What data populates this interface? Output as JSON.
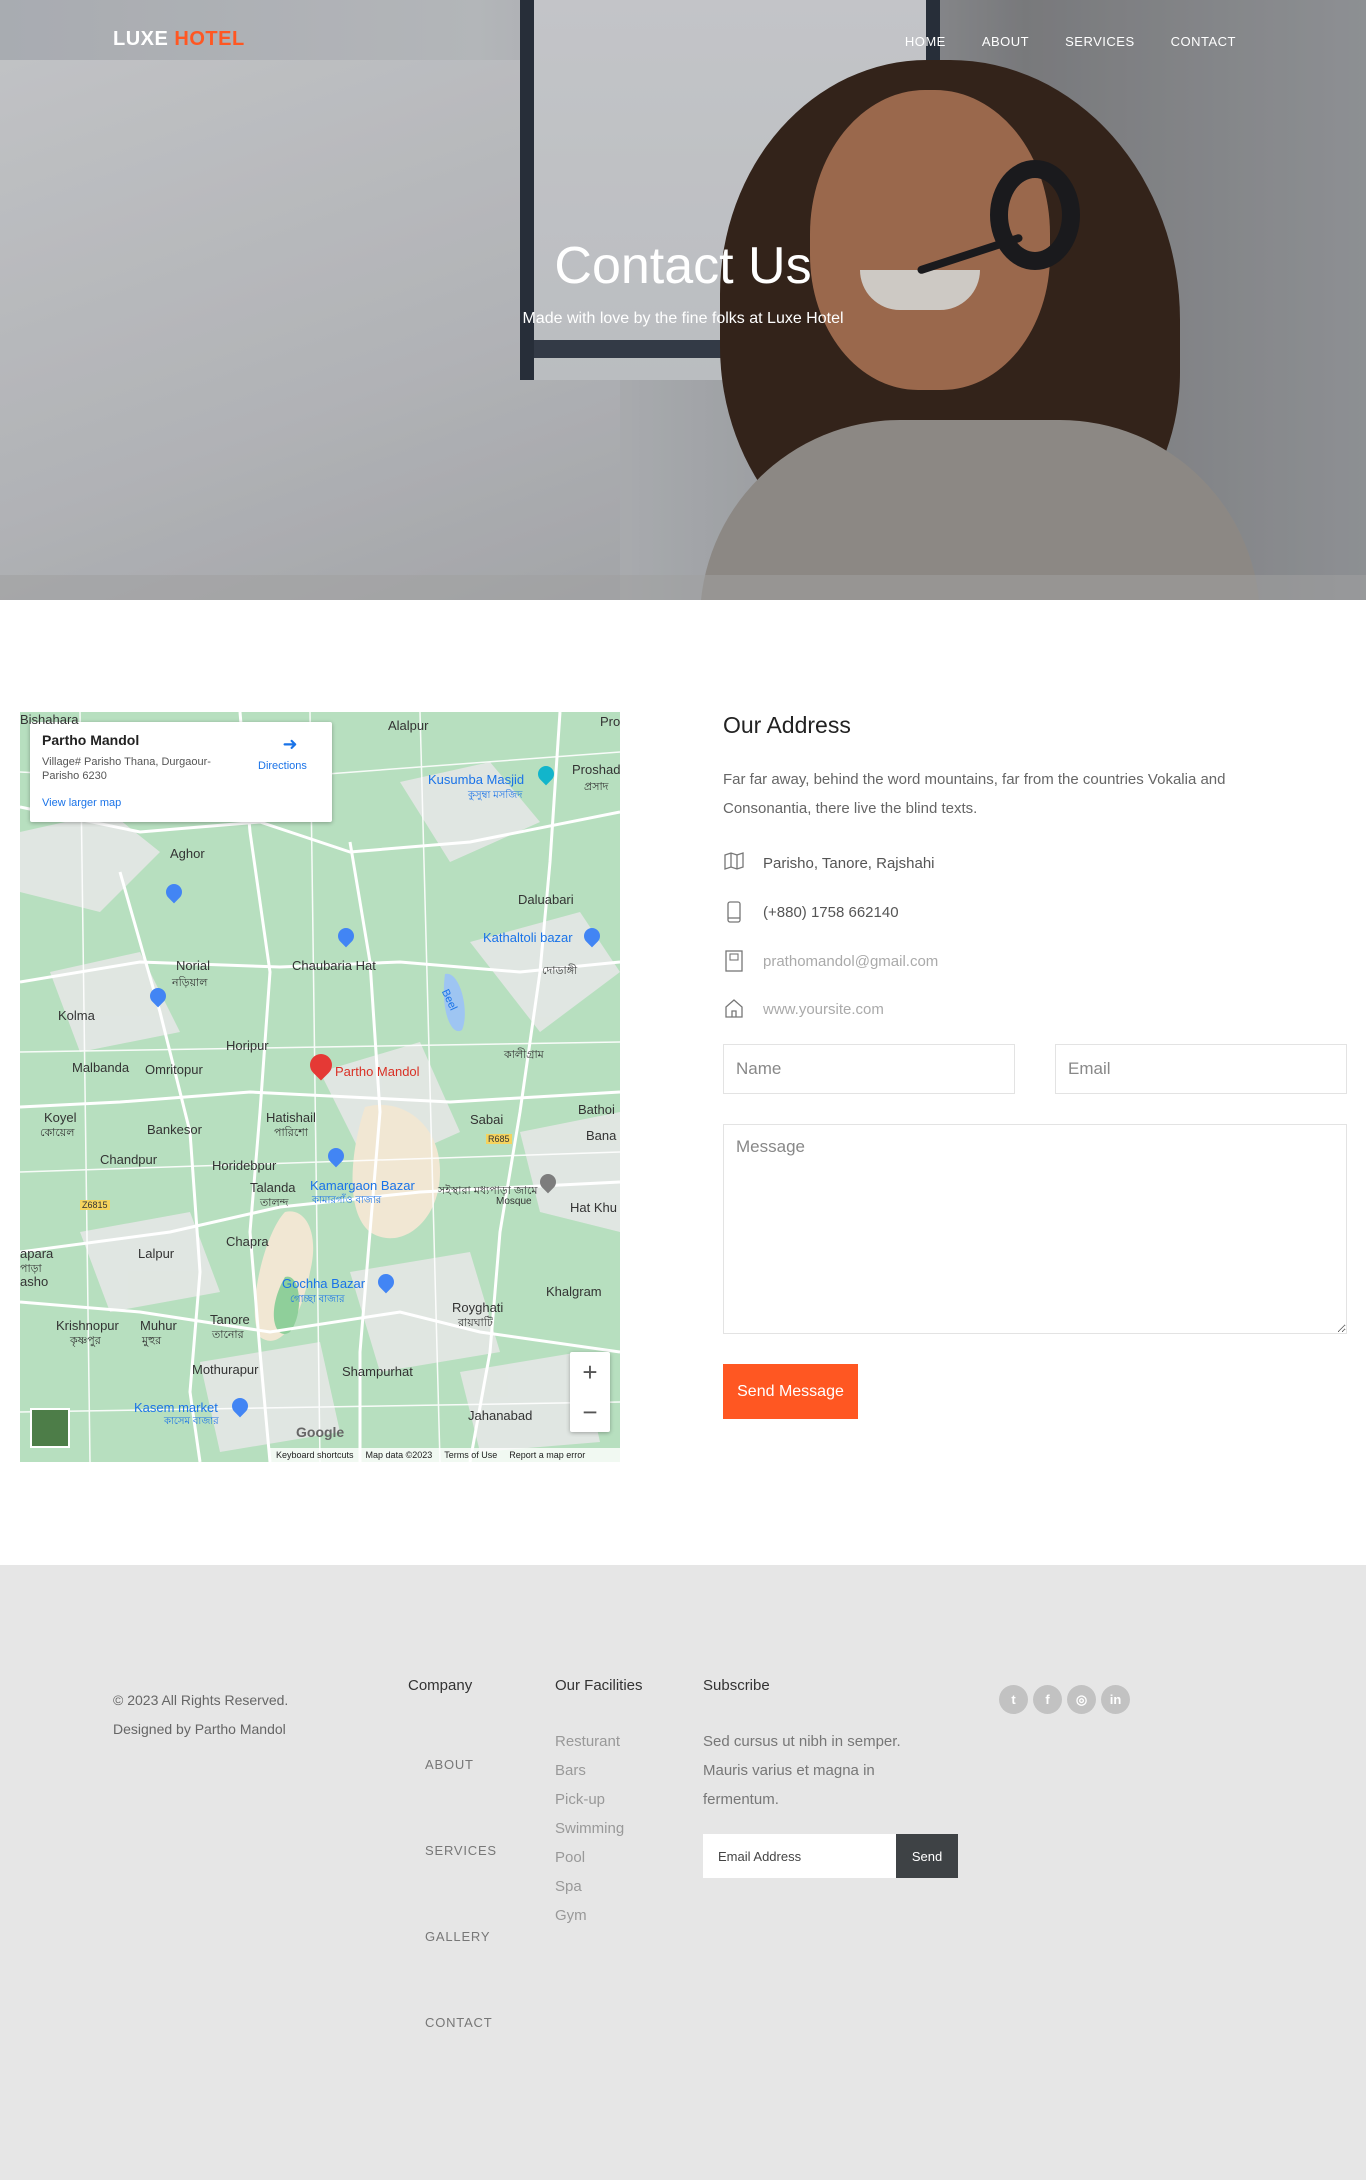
{
  "brand": {
    "name_part1": "LUXE",
    "name_part2": "HOTEL",
    "accent_color": "#ff5722"
  },
  "nav": {
    "items": [
      {
        "label": "HOME"
      },
      {
        "label": "ABOUT"
      },
      {
        "label": "SERVICES"
      },
      {
        "label": "CONTACT"
      }
    ]
  },
  "hero": {
    "title": "Contact Us",
    "subtitle": "Made with love by the fine folks at Luxe Hotel"
  },
  "map": {
    "card": {
      "place": "Partho Mandol",
      "address": "Village# Parisho Thana, Durgaour-Parisho 6230",
      "directions": "Directions",
      "view_larger": "View larger map"
    },
    "labels": {
      "alalpur": "Alalpur",
      "pro": "Pro",
      "kusumba": "Kusumba Masjid",
      "kusumba_bn": "কুসুম্বা মসজিদ",
      "proshad": "Proshad",
      "proshad_bn": "প্রসাদ",
      "aghor": "Aghor",
      "daluabari": "Daluabari",
      "kathaltoli": "Kathaltoli bazar",
      "norial": "Norial",
      "norial_bn": "নড়িয়াল",
      "chaubaria": "Chaubaria Hat",
      "doyaghi": "দোডাঙ্গী",
      "kolma": "Kolma",
      "beel": "Beel",
      "horipur": "Horipur",
      "kaligram": "কালীগ্রাম",
      "malbanda": "Malbanda",
      "omritopur": "Omritopur",
      "partho": "Partho Mandol",
      "koyel": "Koyel",
      "koyel_bn": "কোয়েল",
      "bankesor": "Bankesor",
      "hatishail": "Hatishail",
      "hatishail_bn": "পারিশো",
      "sabai": "Sabai",
      "bathoi": "Bathoi",
      "bana": "Bana",
      "chandpur": "Chandpur",
      "horidebpur": "Horidebpur",
      "r685": "R685",
      "talanda": "Talanda",
      "talanda_bn": "তালন্দ",
      "kamargaon": "Kamargaon Bazar",
      "kamargaon_bn": "কামারগাঁও বাজার",
      "mosque": "Mosque",
      "mosque_bn": "সইস্থারা মধ্যপাড়া জামে",
      "hatkhu": "Hat Khu",
      "z6815": "Z6815",
      "chapra": "Chapra",
      "apara": "apara",
      "apara_bn": "পাড়া",
      "asho": "asho",
      "lalpur": "Lalpur",
      "gochha": "Gochha Bazar",
      "gochha_bn": "গোচ্ছা বাজার",
      "khalgram": "Khalgram",
      "royghati": "Royghati",
      "royghati_bn": "রায়ঘাটি",
      "krishnopur": "Krishnopur",
      "krishnopur_bn": "কৃষ্ণপুর",
      "muhur": "Muhur",
      "muhur_bn": "মুহুর",
      "tanore": "Tanore",
      "tanore_bn": "তানোর",
      "bishahara": "Bishahara",
      "mothurapur": "Mothurapur",
      "shampurhat": "Shampurhat",
      "kasem": "Kasem market",
      "kasem_bn": "কাসেম বাজার",
      "jahanabad": "Jahanabad",
      "google": "Google"
    },
    "zoom_in": "+",
    "zoom_out": "−",
    "footer": {
      "keyboard": "Keyboard shortcuts",
      "mapdata": "Map data ©2023",
      "terms": "Terms of Use",
      "report": "Report a map error"
    }
  },
  "address": {
    "heading": "Our Address",
    "intro": "Far far away, behind the word mountains, far from the countries Vokalia and Consonantia, there live the blind texts.",
    "rows": [
      {
        "icon": "map-icon",
        "text": "Parisho, Tanore, Rajshahi"
      },
      {
        "icon": "phone-icon",
        "text": "(+880) 1758 662140"
      },
      {
        "icon": "mail-icon",
        "text": "prathomandol@gmail.com"
      },
      {
        "icon": "home-icon",
        "text": "www.yoursite.com"
      }
    ]
  },
  "form": {
    "name_placeholder": "Name",
    "email_placeholder": "Email",
    "message_placeholder": "Message",
    "send_label": "Send Message"
  },
  "footer": {
    "copyright": "© 2023 All Rights Reserved.",
    "designed": "Designed by Partho Mandol",
    "company_title": "Company",
    "company_links": [
      "ABOUT",
      "SERVICES",
      "GALLERY",
      "CONTACT"
    ],
    "facilities_title": "Our Facilities",
    "facilities": [
      "Resturant",
      "Bars",
      "Pick-up",
      "Swimming",
      "Pool",
      "Spa",
      "Gym"
    ],
    "subscribe_title": "Subscribe",
    "subscribe_text": "Sed cursus ut nibh in semper. Mauris varius et magna in fermentum.",
    "email_placeholder": "Email Address",
    "send_label": "Send",
    "social": [
      {
        "icon": "twitter-icon",
        "glyph": "t"
      },
      {
        "icon": "facebook-icon",
        "glyph": "f"
      },
      {
        "icon": "instagram-icon",
        "glyph": "◎"
      },
      {
        "icon": "linkedin-icon",
        "glyph": "in"
      }
    ]
  }
}
